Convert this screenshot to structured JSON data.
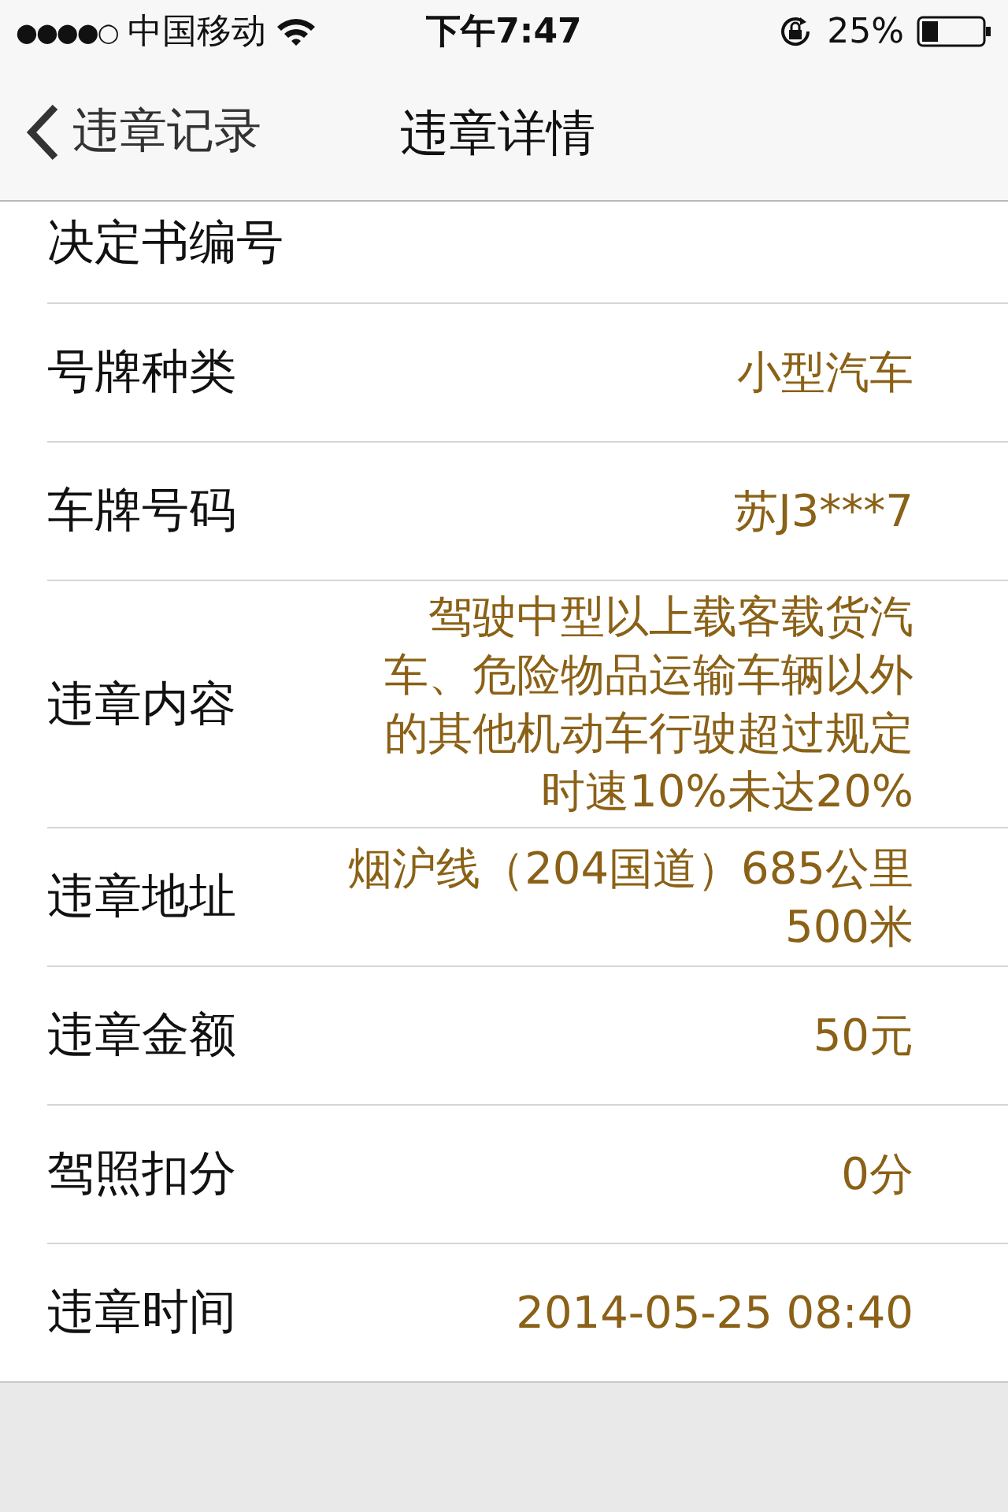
{
  "status_bar": {
    "signal_dots": "●●●●○",
    "carrier": "中国移动",
    "time": "下午7:47",
    "battery": "25%"
  },
  "nav_bar": {
    "back_label": "违章记录",
    "title": "违章详情"
  },
  "rows": [
    {
      "label": "决定书编号"
    },
    {
      "label": "号牌种类",
      "value": "小型汽车"
    },
    {
      "label": "车牌号码",
      "value": "苏J3***7"
    },
    {
      "label": "违章内容",
      "value": "驾驶中型以上载客载货汽车、危险物品运输车辆以外的其他机动车行驶超过规定时速10%未达20%"
    },
    {
      "label": "违章地址",
      "value": "烟沪线（204国道）685公里500米"
    },
    {
      "label": "违章金额",
      "value": "50元"
    },
    {
      "label": "驾照扣分",
      "value": "0分"
    },
    {
      "label": "违章时间",
      "value": "2014-05-25 08:40"
    }
  ]
}
